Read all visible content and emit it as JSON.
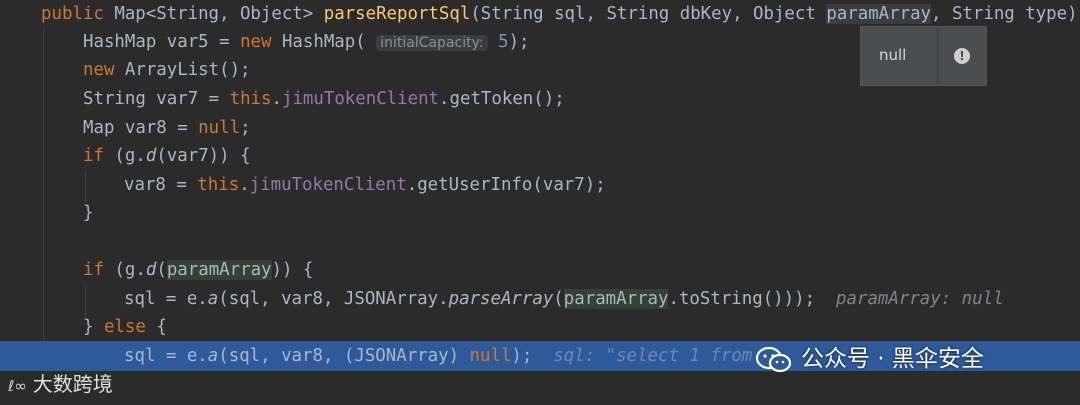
{
  "code": {
    "sig": {
      "kw": "public",
      "type1": "Map<String, Object>",
      "method": "parseReportSql",
      "params_a": "(String sql, String dbKey, Object ",
      "param_hl": "paramArray",
      "params_b": ", String type)"
    },
    "l2": {
      "a": "HashMap var5 = ",
      "kw": "new",
      "b": " HashMap(",
      "hint": "initialCapacity:",
      "num": "5",
      "c": ");"
    },
    "l3": {
      "kw": "new",
      "b": " ArrayList();"
    },
    "l4": {
      "a": "String var7 = ",
      "kw": "this",
      "dot": ".",
      "fld": "jimuTokenClient",
      "b": ".getToken();"
    },
    "l5": {
      "a": "Map var8 = ",
      "kw": "null",
      "b": ";"
    },
    "l6": {
      "kw": "if",
      "a": " (g.",
      "fn": "d",
      "b": "(var7)) {"
    },
    "l7": {
      "a": "var8 = ",
      "kw": "this",
      "dot": ".",
      "fld": "jimuTokenClient",
      "b": ".getUserInfo(var7);"
    },
    "l8": {
      "a": "}"
    },
    "l10": {
      "kw": "if",
      "a": " (g.",
      "fn": "d",
      "b": "(",
      "mark": "paramArray",
      "c": ")) {"
    },
    "l11": {
      "a": "sql = e.",
      "fn": "a",
      "b": "(sql, var8, JSONArray.",
      "fn2": "parseArray",
      "c": "(",
      "mark": "paramArray",
      "d": ".toString()));",
      "inl": "paramArray: null"
    },
    "l12": {
      "a": "} ",
      "kw": "else",
      "b": " {"
    },
    "l13": {
      "a": "sql = e.",
      "fn": "a",
      "b": "(sql, var8, (JSONArray) ",
      "kw": "null",
      "c": ");",
      "inl": "sql: \"select 1 from"
    }
  },
  "tooltip": {
    "value": "null",
    "icon": "exclamation-icon"
  },
  "watermark": {
    "text": "公众号 · 黑伞安全",
    "icon": "wechat-icon"
  },
  "brand": {
    "logo": "ℓ∞",
    "text": "大数跨境"
  }
}
